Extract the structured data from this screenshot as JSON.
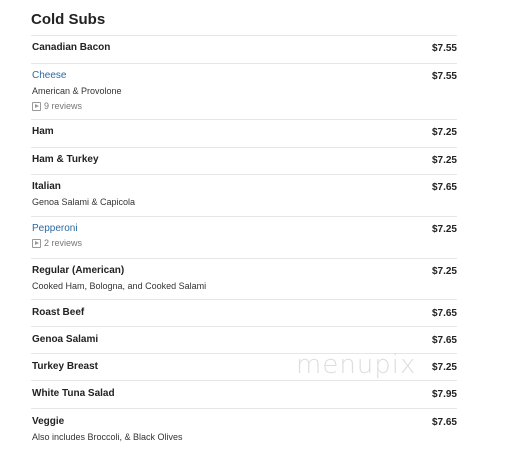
{
  "section": {
    "title": "Cold Subs"
  },
  "items": [
    {
      "name": "Canadian Bacon",
      "price": "$7.55"
    },
    {
      "name": "Cheese",
      "price": "$7.55",
      "desc": "American & Provolone",
      "reviews": "9 reviews"
    },
    {
      "name": "Ham",
      "price": "$7.25"
    },
    {
      "name": "Ham & Turkey",
      "price": "$7.25"
    },
    {
      "name": "Italian",
      "price": "$7.65",
      "desc": "Genoa Salami & Capicola"
    },
    {
      "name": "Pepperoni",
      "price": "$7.25",
      "reviews": "2 reviews"
    },
    {
      "name": "Regular (American)",
      "price": "$7.25",
      "desc": "Cooked Ham, Bologna, and Cooked Salami"
    },
    {
      "name": "Roast Beef",
      "price": "$7.65"
    },
    {
      "name": "Genoa Salami",
      "price": "$7.65"
    },
    {
      "name": "Turkey Breast",
      "price": "$7.25"
    },
    {
      "name": "White Tuna Salad",
      "price": "$7.95"
    },
    {
      "name": "Veggie",
      "price": "$7.65",
      "desc": "Also includes Broccoli, & Black Olives"
    }
  ],
  "watermark": "menupix",
  "icons": {
    "review": "play-box-icon"
  },
  "colors": {
    "link": "#2c6aa0",
    "divider": "#e6e6e6"
  }
}
